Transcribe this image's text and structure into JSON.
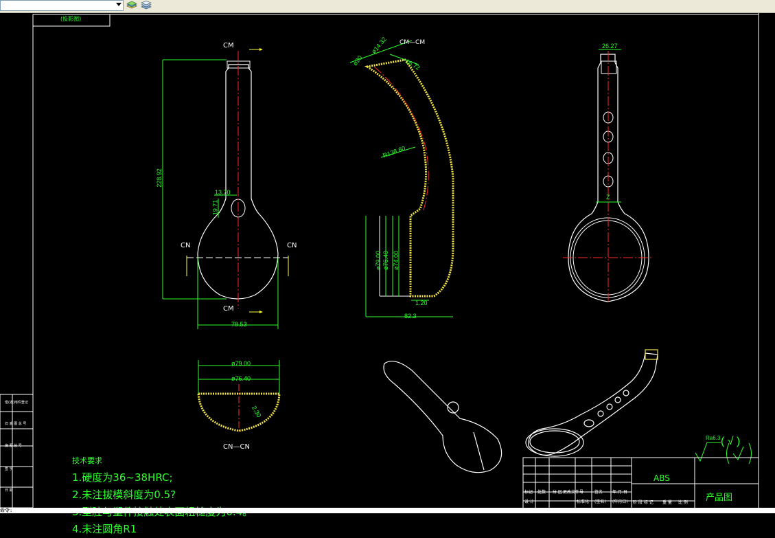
{
  "toolbar": {
    "layer_select_value": "",
    "icons": [
      "layer-stack-icon",
      "layer-states-icon"
    ]
  },
  "drawing": {
    "top_note": "(投影图)",
    "section_labels": {
      "cm_top": "CM",
      "cm_bottom": "CM",
      "cn_left": "CN",
      "cn_right": "CN",
      "cm_cm": "CM—CM",
      "cn_cn": "CN—CN"
    },
    "dimensions": {
      "height_total": "228.92",
      "w_13": "13.70",
      "h_19": "19.71",
      "width_78": "78.53",
      "r_138": "R138.60",
      "d_14": "ø14.32",
      "d_1": "ø20",
      "d_16": "16.72",
      "d_79v": "ø79.00",
      "d_76v": "ø76.40",
      "d_74v": "ø74.00",
      "w_82": "82.3",
      "t_120": "1.20",
      "d_79h": "ø79.00",
      "d_76h": "ø76.40",
      "t_230": "2.30",
      "w_26": "26.27",
      "z": "Z"
    },
    "surface_finish": {
      "symbol_value": "Ra6.3",
      "paren_value": "( √ )"
    }
  },
  "tech_notes": {
    "title": "技术要求",
    "lines": [
      "1.硬度为36~38HRC;",
      "2.未注拔模斜度为0.5?",
      "3.型腔与塑件接触处表面粗糙度为0.4。",
      "4.未注圆角R1"
    ]
  },
  "title_block": {
    "material": "ABS",
    "drawing_name": "产品图",
    "row_labels": [
      "标记",
      "处数",
      "分 区",
      "更改文件号",
      "签名",
      "年.月.日"
    ],
    "row2_labels": [
      "设 计",
      "",
      "",
      "标准化",
      "(签名)",
      "(年月日)"
    ],
    "stage_labels": [
      "阶 段 标 记",
      "重 量",
      "比 例"
    ]
  },
  "left_strip": {
    "labels": [
      "借(通)用件登记",
      "旧 底 图 总 号",
      "底 图 总 号",
      "签 字",
      "日 期"
    ]
  },
  "command_line": {
    "text": "命令:"
  }
}
